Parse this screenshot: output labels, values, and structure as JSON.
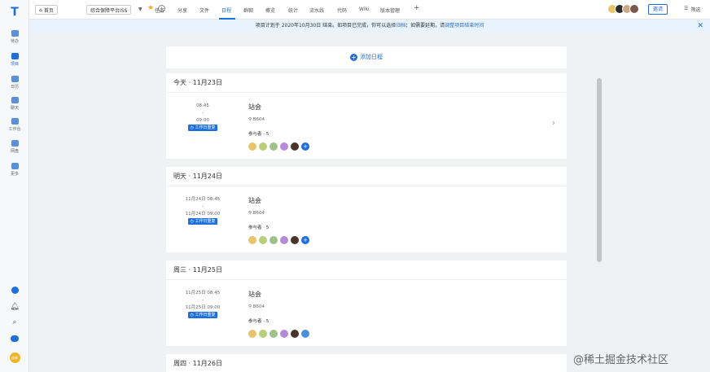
{
  "sidebar": {
    "items": [
      {
        "label": "待办",
        "icon": "todo-icon"
      },
      {
        "label": "项目",
        "icon": "project-icon"
      },
      {
        "label": "日历",
        "icon": "calendar-icon"
      },
      {
        "label": "聊天",
        "icon": "chat-icon"
      },
      {
        "label": "工作台",
        "icon": "workbench-icon"
      },
      {
        "label": "网盘",
        "icon": "drive-icon"
      },
      {
        "label": "更多",
        "icon": "more-icon"
      }
    ],
    "user_avatar_text": "成林"
  },
  "topbar": {
    "home_label": "首页",
    "project_name": "综合保障平台ISS",
    "tabs": [
      "任务",
      "分享",
      "文件",
      "日程",
      "群聊",
      "概览",
      "统计",
      "流水线",
      "代码",
      "Wiki",
      "版本管理",
      "+"
    ],
    "active_tab": "日程",
    "invite_label": "邀请",
    "filter_label": "筛选"
  },
  "notice": {
    "prefix": "项目计划于 2020年10月30日 结束。如项目已完成，你可以选择",
    "link1": "归档",
    "middle": "；如需要延期，请",
    "link2": "调整项目结束时间"
  },
  "schedule": {
    "add_label": "添加日程",
    "days": [
      {
        "header": "今天 · 11月23日",
        "time_start": "08:45",
        "time_sep": "-",
        "time_end": "09:00",
        "repeat": "工作日重复",
        "title": "站会",
        "location": "B604",
        "participants": "参与者 · 5"
      },
      {
        "header": "明天 · 11月24日",
        "time_start": "11月24日 08:45",
        "time_sep": "-",
        "time_end": "11月24日 09:00",
        "repeat": "工作日重复",
        "title": "站会",
        "location": "B604",
        "participants": "参与者 · 5"
      },
      {
        "header": "周三 · 11月25日",
        "time_start": "11月25日 08:45",
        "time_sep": "-",
        "time_end": "11月25日 09:00",
        "repeat": "工作日重复",
        "title": "站会",
        "location": "B604",
        "participants": "参与者 · 5"
      },
      {
        "header": "周四 · 11月26日"
      }
    ]
  },
  "watermark": "@稀土掘金技术社区",
  "colors": {
    "accent": "#1e6fd9",
    "notice_bg": "#e8f3fd",
    "bg": "#f0f1f3"
  }
}
